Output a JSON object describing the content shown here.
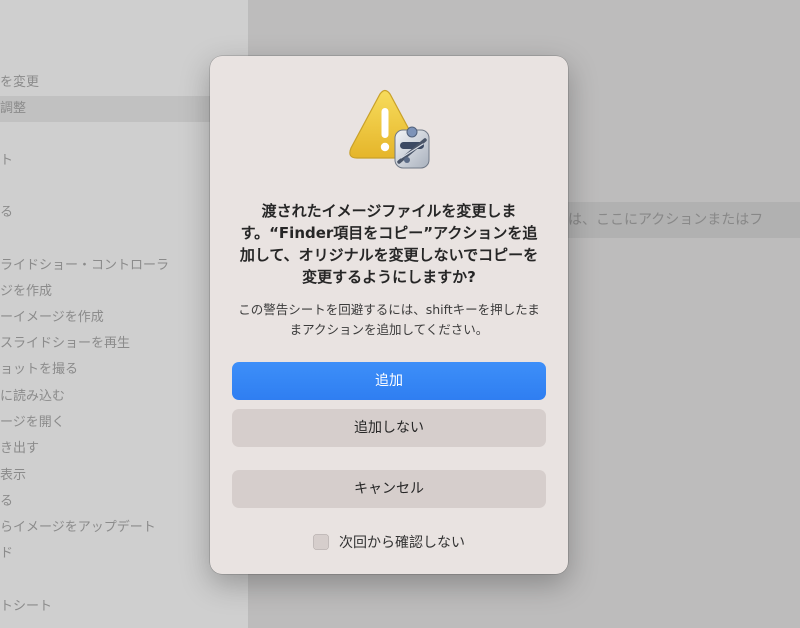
{
  "sidebar": {
    "items": [
      {
        "label": "を変更",
        "selected": false
      },
      {
        "label": "調整",
        "selected": true
      },
      {
        "label": "ト",
        "selected": false
      },
      {
        "label": "る",
        "selected": false
      },
      {
        "label": "ライドショー・コントローラ",
        "selected": false
      },
      {
        "label": "ジを作成",
        "selected": false
      },
      {
        "label": "ーイメージを作成",
        "selected": false
      },
      {
        "label": "スライドショーを再生",
        "selected": false
      },
      {
        "label": "ョットを撮る",
        "selected": false
      },
      {
        "label": "に読み込む",
        "selected": false
      },
      {
        "label": "ージを開く",
        "selected": false
      },
      {
        "label": "き出す",
        "selected": false
      },
      {
        "label": "表示",
        "selected": false
      },
      {
        "label": "る",
        "selected": false
      },
      {
        "label": "らイメージをアップデート",
        "selected": false
      },
      {
        "label": "ド",
        "selected": false
      },
      {
        "label": "トシート",
        "selected": false
      }
    ]
  },
  "content": {
    "hint": "は、ここにアクションまたはフ"
  },
  "alert": {
    "icon": "warning-triangle-automator-icon",
    "title": "渡されたイメージファイルを変更します。“Finder項目をコピー”アクションを追加して、オリジナルを変更しないでコピーを変更するようにしますか?",
    "message": "この警告シートを回避するには、shiftキーを押したままアクションを追加してください。",
    "buttons": {
      "add": "追加",
      "dont_add": "追加しない",
      "cancel": "キャンセル"
    },
    "suppress_label": "次回から確認しない",
    "suppress_checked": false
  },
  "colors": {
    "accent": "#3184f5",
    "sheet_background": "#e9e3e1",
    "secondary_button": "#d6cecc"
  }
}
